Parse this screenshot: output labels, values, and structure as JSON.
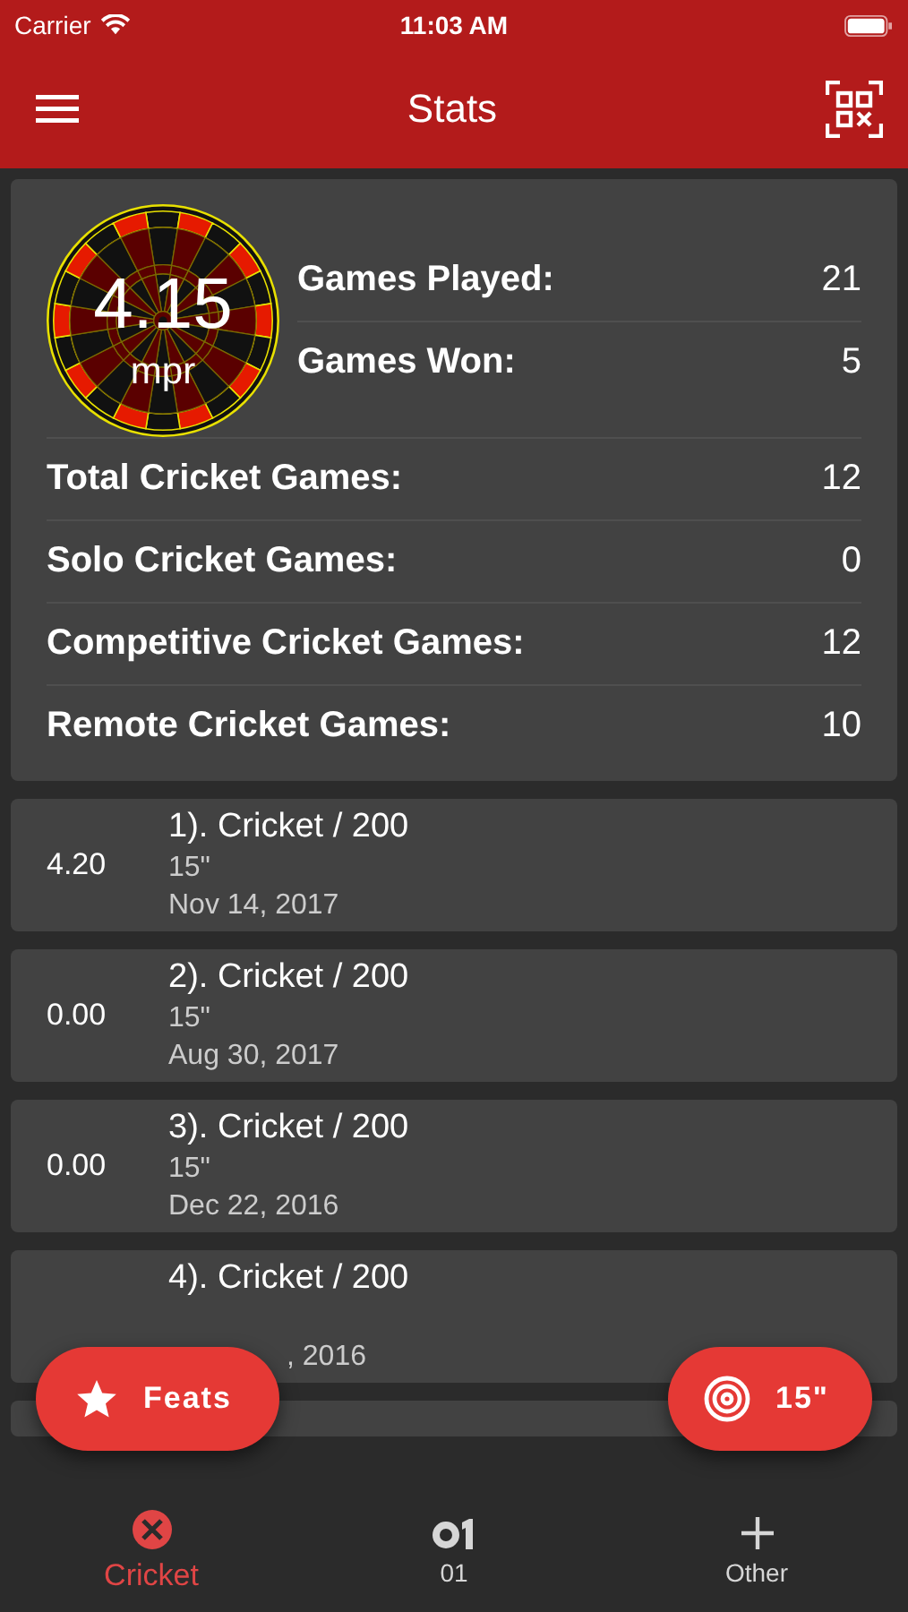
{
  "status_bar": {
    "carrier": "Carrier",
    "time": "11:03 AM"
  },
  "header": {
    "title": "Stats"
  },
  "summary": {
    "mpr": "4.15",
    "mpr_unit": "mpr",
    "top_stats": [
      {
        "label": "Games Played:",
        "value": "21"
      },
      {
        "label": "Games Won:",
        "value": "5"
      }
    ],
    "stats": [
      {
        "label": "Total Cricket Games:",
        "value": "12"
      },
      {
        "label": "Solo Cricket Games:",
        "value": "0"
      },
      {
        "label": "Competitive Cricket Games:",
        "value": "12"
      },
      {
        "label": "Remote Cricket Games:",
        "value": "10"
      }
    ]
  },
  "games": [
    {
      "score": "4.20",
      "title": "1). Cricket / 200",
      "board": "15\"",
      "date": "Nov 14, 2017"
    },
    {
      "score": "0.00",
      "title": "2). Cricket / 200",
      "board": "15\"",
      "date": "Aug 30, 2017"
    },
    {
      "score": "0.00",
      "title": "3). Cricket / 200",
      "board": "15\"",
      "date": "Dec 22, 2016"
    },
    {
      "title": "4). Cricket / 200",
      "date": ", 2016"
    }
  ],
  "fabs": [
    {
      "kind": "star",
      "label": "Feats"
    },
    {
      "kind": "target",
      "label": "15\""
    }
  ],
  "tabs": [
    {
      "kind": "cricket",
      "label": "Cricket",
      "selected": true
    },
    {
      "kind": "digits",
      "label": "01",
      "selected": false
    },
    {
      "kind": "plus",
      "label": "Other",
      "selected": false
    }
  ]
}
